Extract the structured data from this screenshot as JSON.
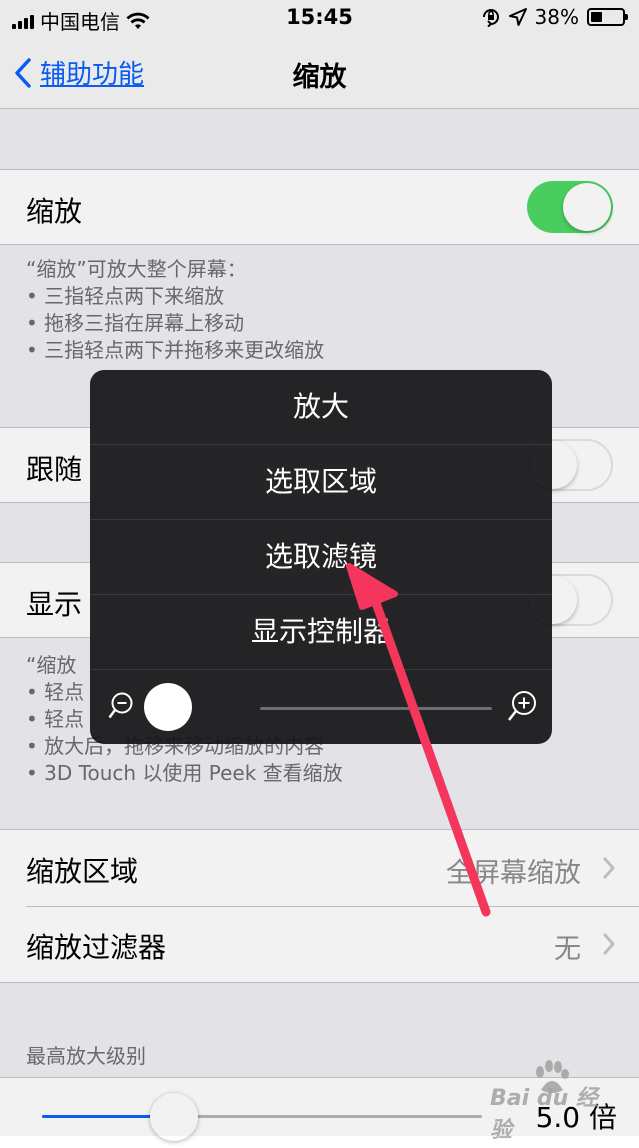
{
  "status_bar": {
    "carrier": "中国电信",
    "time": "15:45",
    "battery_percent": "38%",
    "battery_level": 0.38
  },
  "nav": {
    "back_label": "辅助功能",
    "title": "缩放"
  },
  "zoom_cell": {
    "label": "缩放",
    "toggle_on": true
  },
  "zoom_footnote": {
    "heading": "“缩放”可放大整个屏幕：",
    "items": [
      "三指轻点两下来缩放",
      "拖移三指在屏幕上移动",
      "三指轻点两下并拖移来更改缩放"
    ]
  },
  "follow_focus_cell": {
    "label_visible": "跟随"
  },
  "show_controller_cell": {
    "label_visible": "显示"
  },
  "controller_footnote": {
    "heading_visible": "“缩放",
    "items_visible": [
      "轻点",
      "轻点",
      "放大后，拖移来移动缩放的内容",
      "3D Touch 以使用 Peek 查看缩放"
    ]
  },
  "zoom_region_cell": {
    "label": "缩放区域",
    "value": "全屏幕缩放"
  },
  "zoom_filter_cell": {
    "label": "缩放过滤器",
    "value": "无"
  },
  "max_zoom": {
    "header": "最高放大级别",
    "value": "5.0 倍",
    "slider_level": 0.3
  },
  "zoom_menu": {
    "items": [
      "放大",
      "选取区域",
      "选取滤镜",
      "显示控制器"
    ],
    "slider_level": 0.0
  },
  "watermark": {
    "text": "Bai du 经验"
  },
  "colors": {
    "accent": "#0a60ff",
    "toggle_on": "#4cd964",
    "arrow": "#f5365c"
  }
}
